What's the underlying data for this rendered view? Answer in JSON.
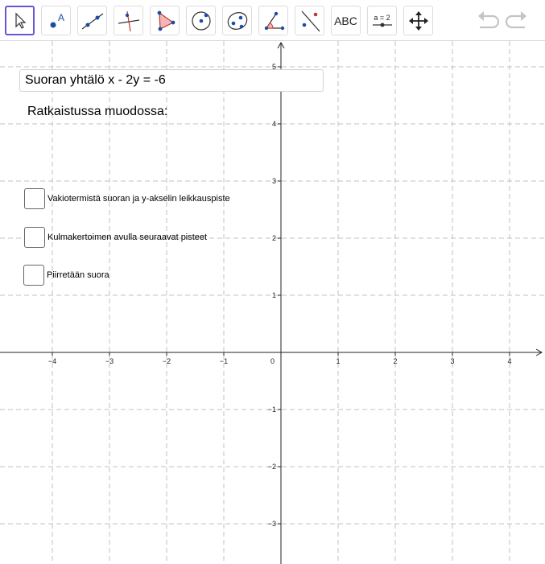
{
  "toolbar": {
    "tools": [
      {
        "name": "move-tool",
        "icon": "arrow-cursor-icon"
      },
      {
        "name": "point-tool",
        "icon": "point-a-icon",
        "letter": "A"
      },
      {
        "name": "line-tool",
        "icon": "line-through-points-icon"
      },
      {
        "name": "perpendicular-line-tool",
        "icon": "perpendicular-line-icon"
      },
      {
        "name": "polygon-tool",
        "icon": "polygon-icon"
      },
      {
        "name": "circle-tool",
        "icon": "circle-center-point-icon"
      },
      {
        "name": "ellipse-tool",
        "icon": "ellipse-icon"
      },
      {
        "name": "angle-tool",
        "icon": "angle-icon"
      },
      {
        "name": "reflect-tool",
        "icon": "reflect-about-line-icon"
      },
      {
        "name": "text-tool",
        "icon": "text-abc-icon",
        "label": "ABC"
      },
      {
        "name": "slider-tool",
        "icon": "slider-icon",
        "label": "a = 2"
      },
      {
        "name": "move-graphics-view-tool",
        "icon": "move-arrows-icon"
      }
    ],
    "undo_icon": "undo-icon",
    "redo_icon": "redo-icon",
    "active_color": "#6557d2"
  },
  "input": {
    "label": "Suoran yhtälö",
    "value": "x - 2y = -6"
  },
  "solved_form_label": "Ratkaistussa muodossa:",
  "checkboxes": [
    {
      "label": "Vakiotermistä suoran ja y-akselin leikkauspiste",
      "checked": false
    },
    {
      "label": "Kulmakertoimen avulla seuraavat pisteet",
      "checked": false
    },
    {
      "label": "Piirretään suora",
      "checked": false
    }
  ],
  "axes": {
    "x_ticks": [
      "−4",
      "−3",
      "−2",
      "−1",
      "1",
      "2",
      "3",
      "4"
    ],
    "y_ticks": [
      "5",
      "4",
      "3",
      "2",
      "1",
      "−1",
      "−2",
      "−3"
    ],
    "origin_label": "0",
    "grid": true,
    "grid_color": "#c0c0c0"
  }
}
